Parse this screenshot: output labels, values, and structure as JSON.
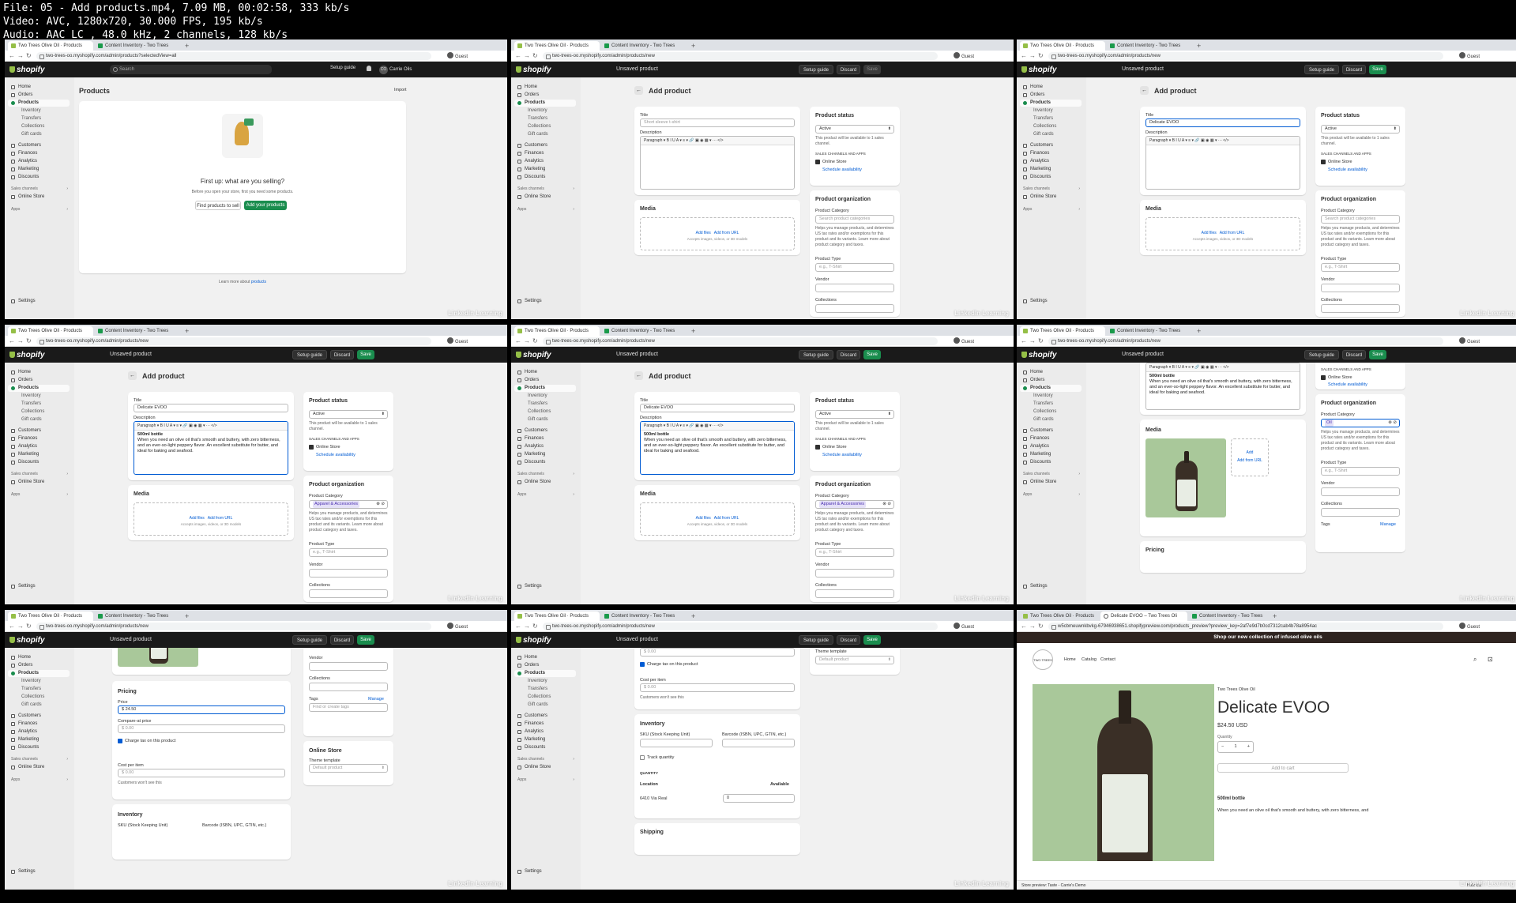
{
  "file_info": {
    "line1": "File: 05 - Add products.mp4, 7.09 MB, 00:02:58, 333 kb/s",
    "line2": "Video: AVC, 1280x720, 30.000 FPS, 195 kb/s",
    "line3": "Audio: AAC LC , 48.0 kHz, 2 channels, 128 kb/s"
  },
  "browser": {
    "tab1": "Two Trees Olive Oil · Products",
    "tab2": "Content Inventory - Two Trees",
    "tab_preview": "Delicate EVOO – Two Trees Oli",
    "guest": "Guest",
    "url_products": "two-trees-oo.myshopify.com/admin/products?selectedView=all",
    "url_new": "two-trees-oo.myshopify.com/admin/products/new",
    "url_preview": "w5cbmeuwnkbvkg-67946938651.shopifypreview.com/products_preview?preview_key=2af7e9d7b0cd7312cab4b78a8954ac"
  },
  "admin": {
    "logo": "shopify",
    "search_placeholder": "Search",
    "setup_guide": "Setup guide",
    "user_initials": "CO",
    "user_name": "Carrie Oils",
    "unsaved": "Unsaved product",
    "discard": "Discard",
    "save": "Save",
    "sidebar": {
      "home": "Home",
      "orders": "Orders",
      "products": "Products",
      "inventory": "Inventory",
      "transfers": "Transfers",
      "collections": "Collections",
      "gift_cards": "Gift cards",
      "customers": "Customers",
      "finances": "Finances",
      "analytics": "Analytics",
      "marketing": "Marketing",
      "discounts": "Discounts",
      "sales_channels": "Sales channels",
      "online_store": "Online Store",
      "apps": "Apps",
      "settings": "Settings"
    }
  },
  "products_page": {
    "title": "Products",
    "import": "Import",
    "heading": "First up: what are you selling?",
    "subtext": "Before you open your store, first you need some products.",
    "find_btn": "Find products to sell",
    "add_btn": "Add your products",
    "learn_prefix": "Learn more about",
    "learn_link": "products"
  },
  "add_product": {
    "page_title": "Add product",
    "title_label": "Title",
    "title_placeholder": "Short sleeve t-shirt",
    "title_value": "Delicate EVOO",
    "description_label": "Description",
    "toolbar": "Paragraph  ▾   B  I  U  A ▾   ≡ ▾   🔗  ▣  ◉  ▦ ▾   ···   </>",
    "desc_heading": "500ml bottle",
    "desc_text": "When you need an olive oil that's smooth and buttery, with zero bitterness, and an ever-so-light peppery flavor. An excellent substitute for butter, and ideal for baking and seafood.",
    "media_label": "Media",
    "add_files": "Add files",
    "add_from_url": "Add from URL",
    "media_hint": "Accepts images, videos, or 3D models",
    "add": "Add",
    "status_label": "Product status",
    "status_value": "Active",
    "status_help": "This product will be available to 1 sales channel.",
    "sales_channels": "SALES CHANNELS AND APPS",
    "online_store": "Online Store",
    "schedule": "Schedule availability",
    "org_label": "Product organization",
    "category_label": "Product Category",
    "category_placeholder": "Search product categories",
    "category_value": "Apparel & Accessories",
    "category_value2": "Oil",
    "category_help": "Helps you manage products, and determines US tax rates and/or exemptions for this product and its variants. Learn more about product category and taxes.",
    "type_label": "Product Type",
    "type_placeholder": "e.g., T-Shirt",
    "vendor": "Vendor",
    "collections": "Collections",
    "tags": "Tags",
    "manage": "Manage",
    "tags_placeholder": "Find or create tags",
    "online_store_card": "Online Store",
    "theme_template": "Theme template",
    "default_product": "Default product",
    "pricing": "Pricing",
    "price": "Price",
    "price_value": "$  24.50",
    "compare": "Compare-at price",
    "zero": "$  0.00",
    "charge_tax": "Charge tax on this product",
    "cost": "Cost per item",
    "customers_wont": "Customers won't see this",
    "inventory": "Inventory",
    "sku": "SKU (Stock Keeping Unit)",
    "barcode": "Barcode (ISBN, UPC, GTIN, etc.)",
    "track": "Track quantity",
    "quantity": "QUANTITY",
    "location": "Location",
    "available": "Available",
    "address": "6410 Via Real",
    "qty": "0",
    "shipping": "Shipping"
  },
  "storefront": {
    "banner": "Shop our new collection of infused olive oils",
    "nav_home": "Home",
    "nav_catalog": "Catalog",
    "nav_contact": "Contact",
    "logo_text": "TWO TREES",
    "vendor": "Two Trees Olive Oil",
    "title": "Delicate EVOO",
    "price": "$24.50 USD",
    "quantity": "Quantity",
    "qty": "1",
    "add_to_cart": "Add to cart",
    "size": "500ml bottle",
    "desc": "When you need an olive oil that's smooth and buttery, with zero bitterness, and",
    "store_preview": "Store preview: Taste - Carrie's Demo",
    "hide": "Hide bar"
  },
  "watermark": "LinkedIn Learning",
  "colors": {
    "shopify_green": "#95bf47",
    "save_green": "#1a8d4e",
    "link_blue": "#005bd3",
    "topbar": "#1a1a1a"
  }
}
